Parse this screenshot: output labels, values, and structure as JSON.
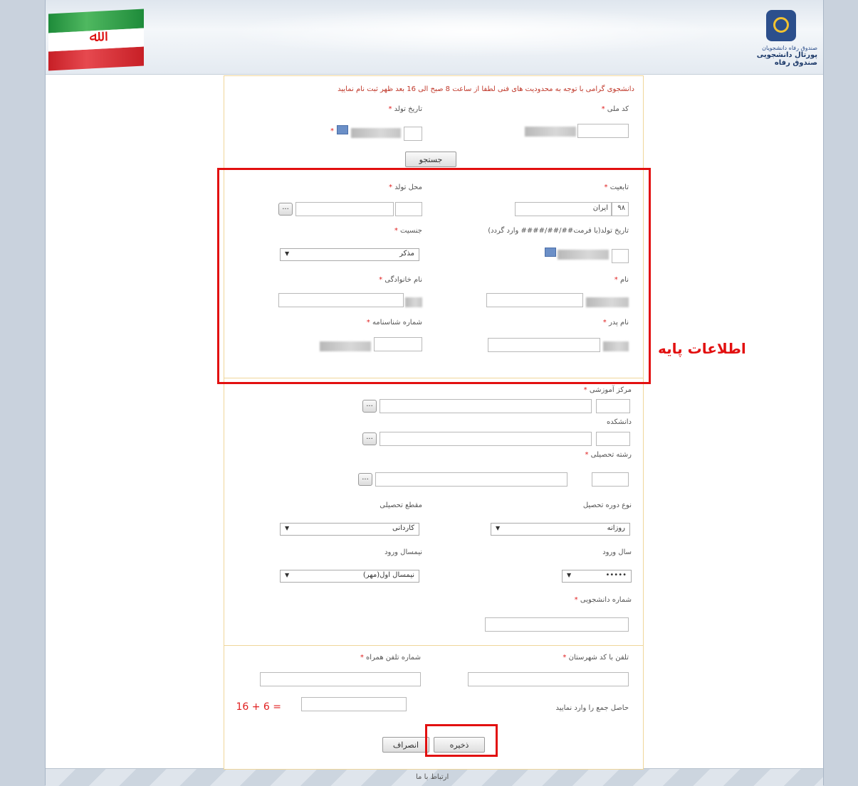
{
  "header": {
    "logo_subtitle": "صندوق رفاه دانشجویان",
    "portal_title": "پورتال دانشجویی صندوق رفاه"
  },
  "notice": "دانشجوی گرامی با توجه به محدودیت های فنی لطفا از ساعت 8 صبح الی 16 بعد ظهر ثبت نام نمایید",
  "search": {
    "national_code_label": "کد ملی",
    "birth_date_label": "تاریخ تولد",
    "search_button": "جستجو"
  },
  "basic_info": {
    "annotation": "اطلاعات پایه",
    "nationality_label": "تابعیت",
    "nationality_code": "۹۸",
    "nationality_value": "ایران",
    "birth_place_label": "محل تولد",
    "birth_date_label": "تاریخ تولد(با فرمت##/##/#### وارد گردد)",
    "gender_label": "جنسیت",
    "gender_value": "مذکر",
    "first_name_label": "نام",
    "last_name_label": "نام خانوادگی",
    "father_name_label": "نام پدر",
    "id_number_label": "شماره شناسنامه"
  },
  "education": {
    "center_label": "مرکز آموزشی",
    "faculty_label": "دانشکده",
    "major_label": "رشته تحصیلی",
    "course_type_label": "نوع دوره تحصیل",
    "course_type_value": "روزانه",
    "degree_label": "مقطع تحصیلی",
    "degree_value": "کاردانی",
    "entry_year_label": "سال ورود",
    "entry_year_value": "•••••",
    "entry_semester_label": "نیمسال ورود",
    "entry_semester_value": "نیمسال اول(مهر)",
    "student_number_label": "شماره دانشجویی"
  },
  "contact": {
    "phone_label": "تلفن با کد شهرستان",
    "mobile_label": "شماره تلفن همراه",
    "captcha_label": "حاصل جمع را وارد نمایید",
    "captcha_question": "16 + 6 ="
  },
  "actions": {
    "save": "ذخیره",
    "cancel": "انصراف"
  },
  "footer": {
    "contact_link": "ارتباط با ما"
  },
  "colors": {
    "required": "#e02020",
    "highlight": "#e21010",
    "form_border": "#f0d69a"
  }
}
